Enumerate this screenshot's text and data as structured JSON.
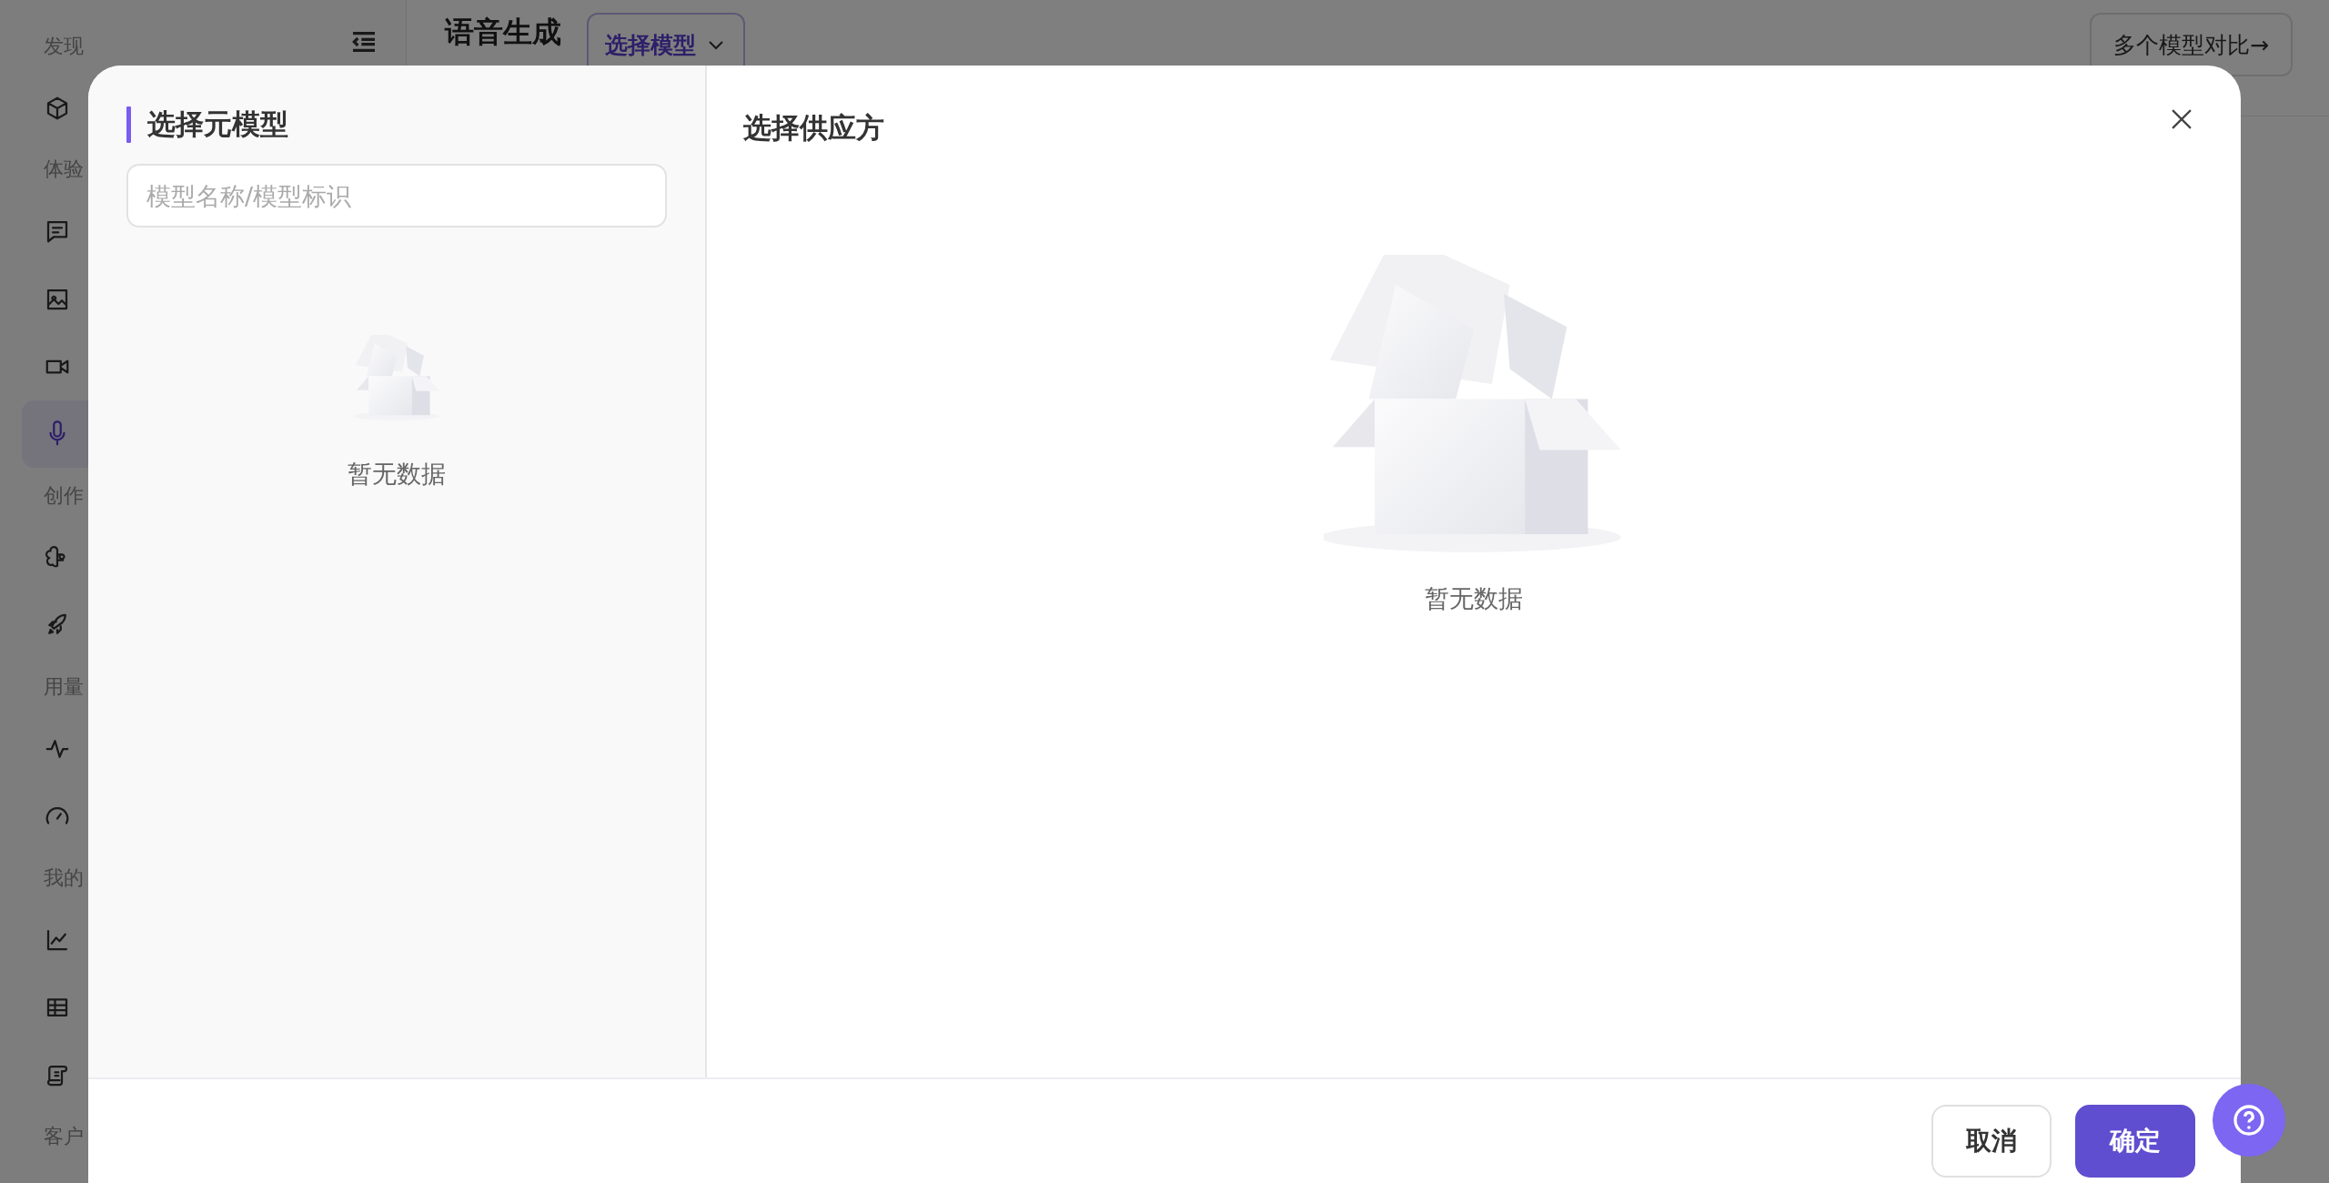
{
  "sidebar": {
    "sections": [
      {
        "label": "发现",
        "items": [
          {
            "selected": false
          }
        ]
      },
      {
        "label": "体验",
        "items": [
          {
            "selected": false
          },
          {
            "selected": false
          },
          {
            "selected": false
          },
          {
            "selected": true
          }
        ]
      },
      {
        "label": "创作",
        "items": [
          {
            "selected": false
          },
          {
            "selected": false
          }
        ]
      },
      {
        "label": "用量",
        "items": [
          {
            "selected": false
          },
          {
            "selected": false
          }
        ]
      },
      {
        "label": "我的",
        "items": [
          {
            "selected": false
          },
          {
            "selected": false
          },
          {
            "selected": false
          }
        ]
      },
      {
        "label": "客户"
      }
    ]
  },
  "header": {
    "title": "语音生成",
    "model_select": "选择模型",
    "compare_button": "多个模型对比→"
  },
  "dialog": {
    "left": {
      "title": "选择元模型",
      "search": {
        "placeholder": "模型名称/模型标识"
      },
      "empty_text": "暂无数据"
    },
    "right": {
      "title": "选择供应方",
      "empty_text": "暂无数据"
    },
    "buttons": [
      {
        "label": "取消",
        "kind": "secondary"
      },
      {
        "label": "确定",
        "kind": "primary"
      }
    ]
  }
}
